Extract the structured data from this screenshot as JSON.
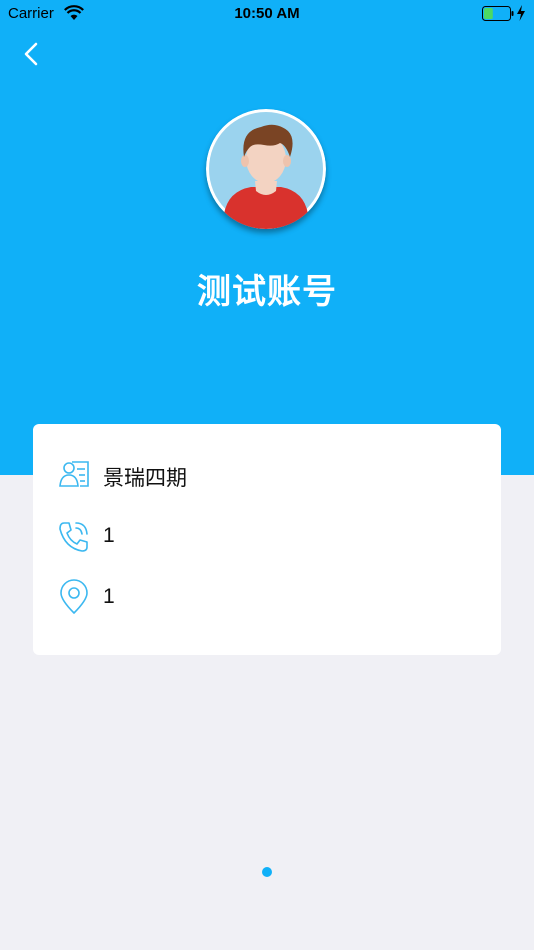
{
  "status_bar": {
    "carrier": "Carrier",
    "time": "10:50 AM",
    "battery_level": 0.35,
    "charging": true
  },
  "header": {
    "back_icon": "chevron-left-icon",
    "user_name": "测试账号",
    "background_color": "#10b0f8"
  },
  "info_card": {
    "rows": [
      {
        "icon": "id-card-icon",
        "value": "景瑞四期"
      },
      {
        "icon": "phone-icon",
        "value": "1"
      },
      {
        "icon": "location-pin-icon",
        "value": "1"
      }
    ]
  },
  "pager": {
    "page_count": 1,
    "current_page": 1
  },
  "colors": {
    "accent": "#10b0f8",
    "icon_stroke": "#3cb8f0",
    "page_background": "#f0f0f5"
  }
}
